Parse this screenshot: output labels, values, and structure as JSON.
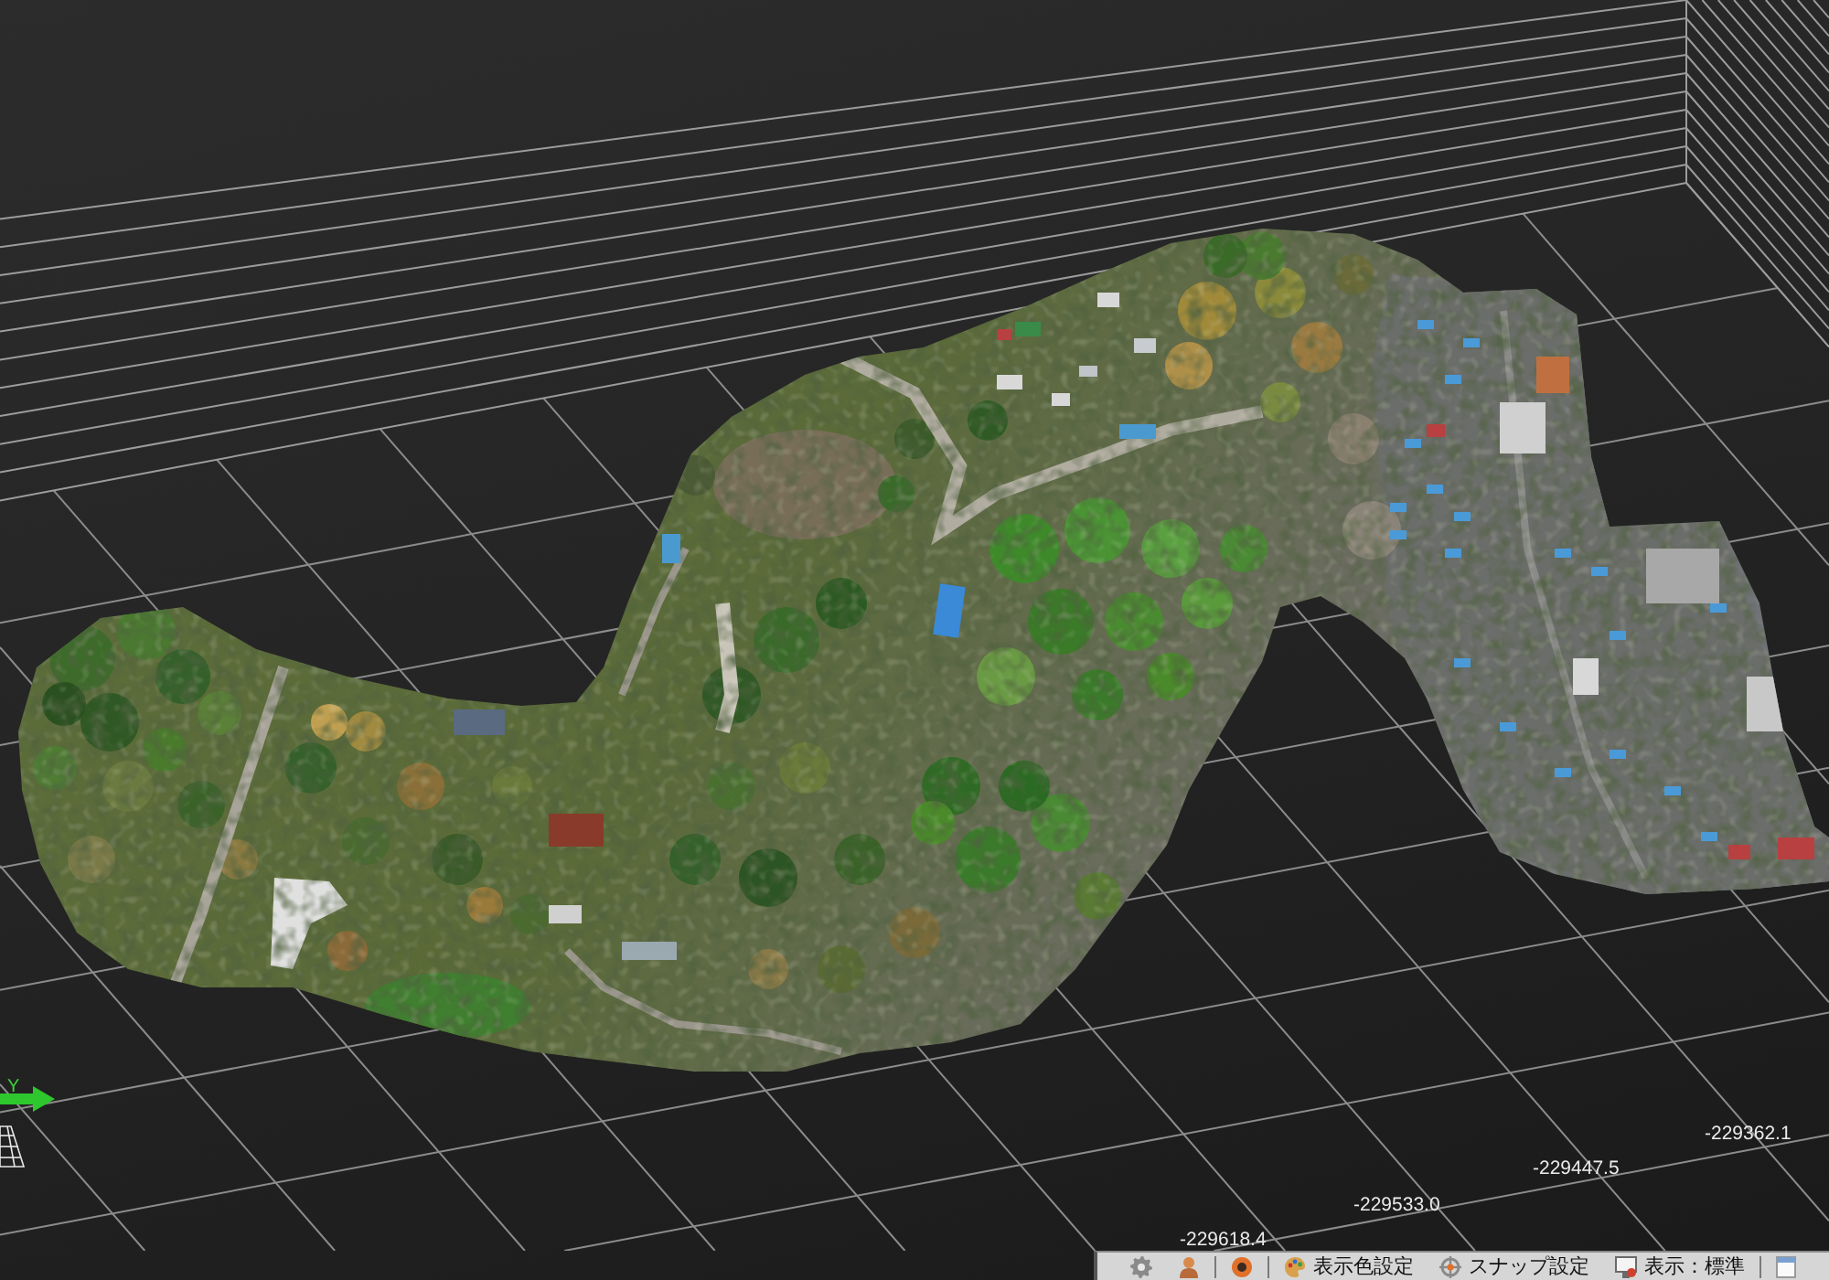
{
  "viewport": {
    "axis_label": "Y",
    "coordinate_labels": [
      "-229618.4",
      "-229533.0",
      "-229447.5",
      "-229362.1"
    ]
  },
  "toolbar": {
    "buttons": [
      {
        "label": "表示色設定"
      },
      {
        "label": "スナップ設定"
      },
      {
        "label": "表示：標準"
      }
    ]
  }
}
